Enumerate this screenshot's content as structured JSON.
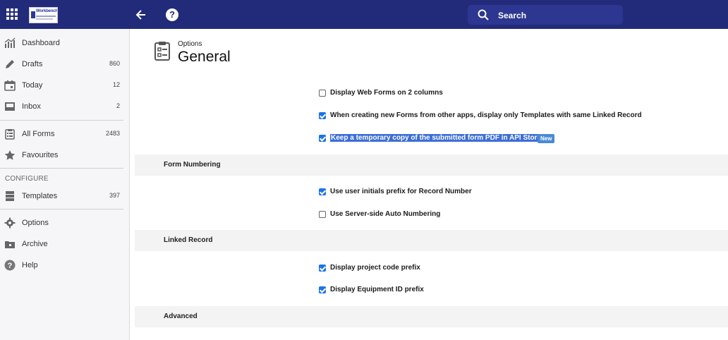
{
  "header": {
    "logo_text": "Workbench",
    "search_label": "Search",
    "help_glyph": "?"
  },
  "sidebar": {
    "items": [
      {
        "label": "Dashboard",
        "count": "",
        "icon": "chart-icon"
      },
      {
        "label": "Drafts",
        "count": "860",
        "icon": "pencil-icon"
      },
      {
        "label": "Today",
        "count": "12",
        "icon": "calendar-icon"
      },
      {
        "label": "Inbox",
        "count": "2",
        "icon": "inbox-icon"
      },
      {
        "label": "All Forms",
        "count": "2483",
        "icon": "clipboard-icon"
      },
      {
        "label": "Favourites",
        "count": "",
        "icon": "star-icon"
      },
      {
        "label": "Templates",
        "count": "397",
        "icon": "templates-icon"
      },
      {
        "label": "Options",
        "count": "",
        "icon": "gear-icon"
      },
      {
        "label": "Archive",
        "count": "",
        "icon": "archive-icon"
      },
      {
        "label": "Help",
        "count": "",
        "icon": "help-icon"
      }
    ],
    "configure_title": "CONFIGURE"
  },
  "page": {
    "breadcrumb": "Options",
    "title": "General"
  },
  "options": {
    "general": [
      {
        "label": "Display Web Forms on 2 columns",
        "checked": false
      },
      {
        "label": "When creating new Forms from other apps, display only Templates with same Linked Record",
        "checked": true
      },
      {
        "label": "Keep a temporary copy of the submitted form PDF in API Store",
        "checked": true,
        "badge": "New"
      }
    ],
    "form_numbering_title": "Form Numbering",
    "form_numbering": [
      {
        "label": "Use user initials prefix for Record Number",
        "checked": true
      },
      {
        "label": "Use Server-side Auto Numbering",
        "checked": false
      }
    ],
    "linked_record_title": "Linked Record",
    "linked_record": [
      {
        "label": "Display project code prefix",
        "checked": true
      },
      {
        "label": "Display Equipment ID prefix",
        "checked": true
      }
    ],
    "advanced_title": "Advanced"
  },
  "colors": {
    "topbar": "#222a7a",
    "checkbox": "#1a73e8",
    "selection": "#3d6ed6",
    "badge": "#4a8ad6"
  }
}
